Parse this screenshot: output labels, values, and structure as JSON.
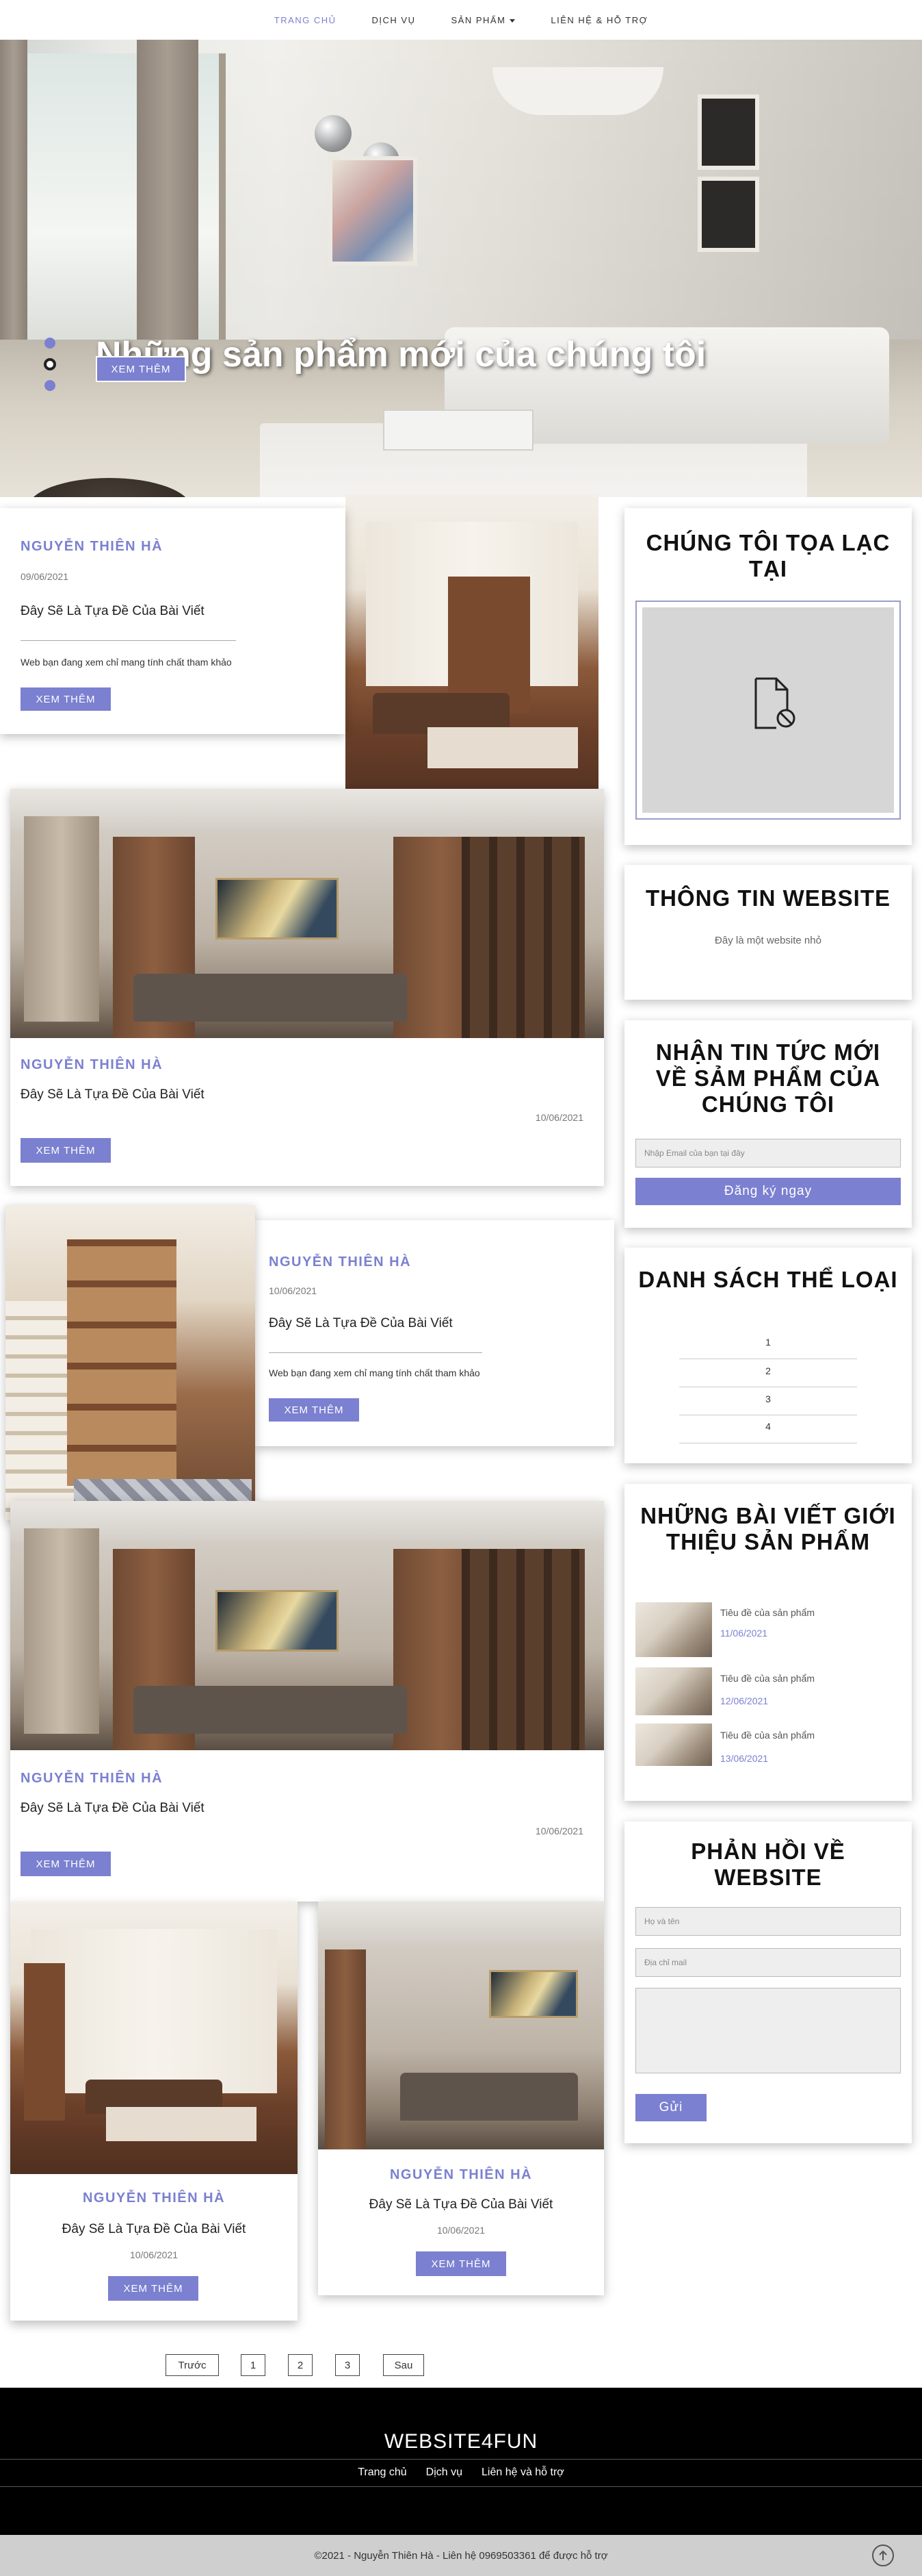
{
  "nav": {
    "items": [
      {
        "label": "TRANG CHỦ"
      },
      {
        "label": "DỊCH VỤ"
      },
      {
        "label": "SẢN PHẨM"
      },
      {
        "label": "LIÊN HỆ & HỖ TRỢ"
      }
    ]
  },
  "hero": {
    "title": "Những sản phẩm mới của chúng tôi",
    "button": "XEM THÊM"
  },
  "posts": [
    {
      "author": "NGUYỄN THIÊN HÀ",
      "date": "09/06/2021",
      "title": "Đây Sẽ Là Tựa Đề Của Bài Viết",
      "desc": "Web bạn đang xem chỉ mang tính chất tham khảo",
      "button": "XEM THÊM"
    },
    {
      "author": "NGUYỄN THIÊN HÀ",
      "date": "10/06/2021",
      "title": "Đây Sẽ Là Tựa Đề Của Bài Viết",
      "button": "XEM THÊM"
    },
    {
      "author": "NGUYỄN THIÊN HÀ",
      "date": "10/06/2021",
      "title": "Đây Sẽ Là Tựa Đề Của Bài Viết",
      "desc": "Web bạn đang xem chỉ mang tính chất tham khảo",
      "button": "XEM THÊM"
    },
    {
      "author": "NGUYỄN THIÊN HÀ",
      "date": "10/06/2021",
      "title": "Đây Sẽ Là Tựa Đề Của Bài Viết",
      "button": "XEM THÊM"
    },
    {
      "author": "NGUYỄN THIÊN HÀ",
      "date": "10/06/2021",
      "title": "Đây Sẽ Là Tựa Đề Của Bài Viết",
      "button": "XEM THÊM"
    },
    {
      "author": "NGUYỄN THIÊN HÀ",
      "date": "10/06/2021",
      "title": "Đây Sẽ Là Tựa Đề Của Bài Viết",
      "button": "XEM THÊM"
    }
  ],
  "sidebar": {
    "location_title": "CHÚNG TÔI TỌA LẠC TẠI",
    "info_title": "THÔNG TIN WEBSITE",
    "info_text": "Đây là một website nhỏ",
    "newsletter_title": "NHẬN TIN TỨC MỚI VỀ SẢM PHẨM CỦA CHÚNG TÔI",
    "newsletter_placeholder": "Nhập Email của bạn tại đây",
    "newsletter_button": "Đăng ký ngay",
    "categories_title": "DANH SÁCH THỂ LOẠI",
    "categories": [
      "1",
      "2",
      "3",
      "4"
    ],
    "featured_title": "NHỮNG BÀI VIẾT GIỚI THIỆU SẢN PHẨM",
    "featured": [
      {
        "title": "Tiêu đề của sản phẩm",
        "date": "11/06/2021"
      },
      {
        "title": "Tiêu đề của sản phẩm",
        "date": "12/06/2021"
      },
      {
        "title": "Tiêu đề của sản phẩm",
        "date": "13/06/2021"
      }
    ],
    "feedback_title": "PHẢN HỒI VỀ WEBSITE",
    "feedback_name_placeholder": "Họ và tên",
    "feedback_email_placeholder": "Địa chỉ mail",
    "feedback_button": "Gửi"
  },
  "pagination": {
    "prev": "Trước",
    "pages": [
      "1",
      "2",
      "3"
    ],
    "next": "Sau"
  },
  "footer": {
    "brand": "WEBSITE4FUN",
    "links": [
      "Trang chủ",
      "Dịch vụ",
      "Liên hệ và hỗ trợ"
    ],
    "copyright": "©2021 - Nguyễn Thiên Hà - Liên hệ 0969503361 để được hỗ trợ"
  },
  "colors": {
    "accent": "#7b80d0",
    "footer_bg": "#000000",
    "copyright_bg": "#cfcfcf"
  }
}
